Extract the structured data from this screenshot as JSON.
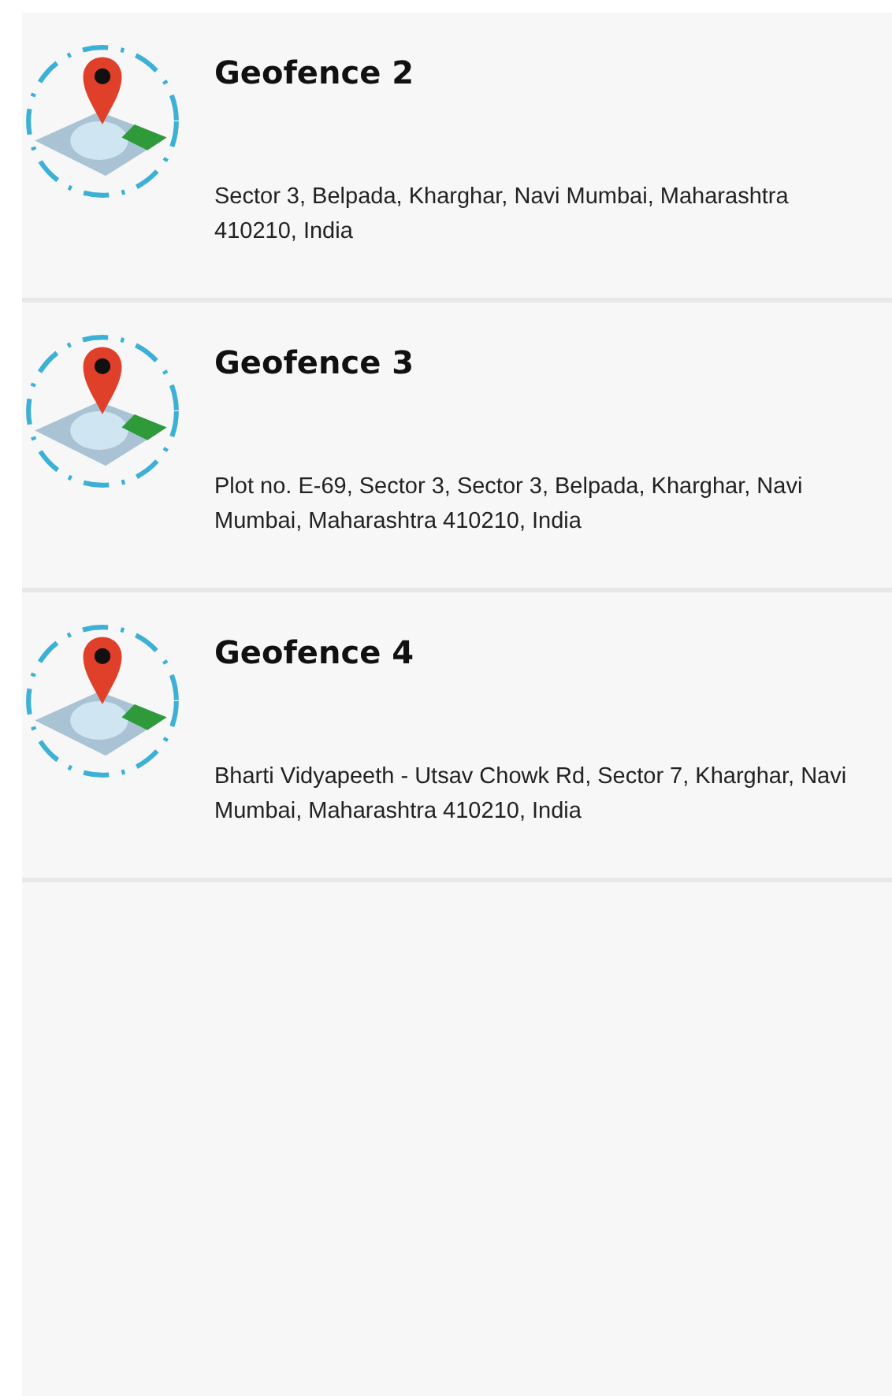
{
  "geofences": [
    {
      "title": "Geofence 2",
      "address": "Sector 3, Belpada, Kharghar, Navi Mumbai, Maharashtra 410210, India"
    },
    {
      "title": "Geofence 3",
      "address": "Plot no. E-69, Sector 3, Sector 3, Belpada, Kharghar, Navi Mumbai, Maharashtra 410210, India"
    },
    {
      "title": "Geofence 4",
      "address": "Bharti Vidyapeeth - Utsav Chowk Rd, Sector 7, Kharghar, Navi Mumbai, Maharashtra 410210, India"
    }
  ]
}
